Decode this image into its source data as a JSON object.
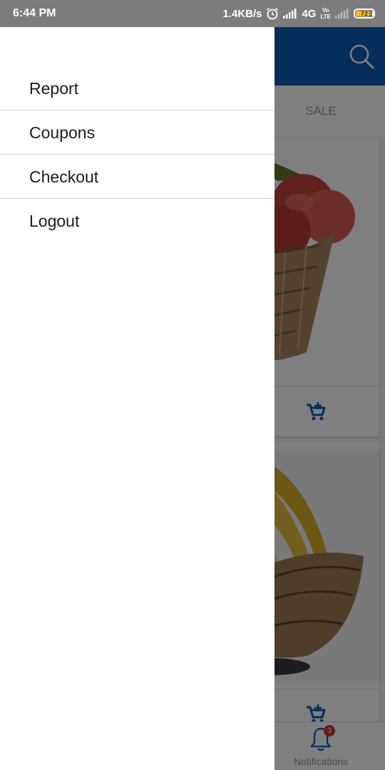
{
  "status_bar": {
    "time": "6:44 PM",
    "network_speed": "1.4KB/s",
    "network_type": "4G",
    "sim2_label_top": "Vo",
    "sim2_label_bottom": "LTE",
    "battery_level": "72",
    "battery_color": "#f1b824"
  },
  "app": {
    "brand_color": "#0b5db8",
    "search_icon": "search-icon",
    "tabs": [
      {
        "label": "SALE"
      }
    ],
    "products": [
      {
        "image": "apples-in-basket",
        "cart_icon": "add-to-cart-icon"
      },
      {
        "image": "bananas-in-bowl",
        "cart_icon": "add-to-cart-icon"
      }
    ],
    "bottom_nav": {
      "notifications_label": "Notifications",
      "notifications_badge": "3",
      "badge_color": "#d32f2f"
    }
  },
  "drawer": {
    "menu": [
      {
        "label": "Report"
      },
      {
        "label": "Coupons"
      },
      {
        "label": "Checkout"
      },
      {
        "label": "Logout"
      }
    ]
  }
}
